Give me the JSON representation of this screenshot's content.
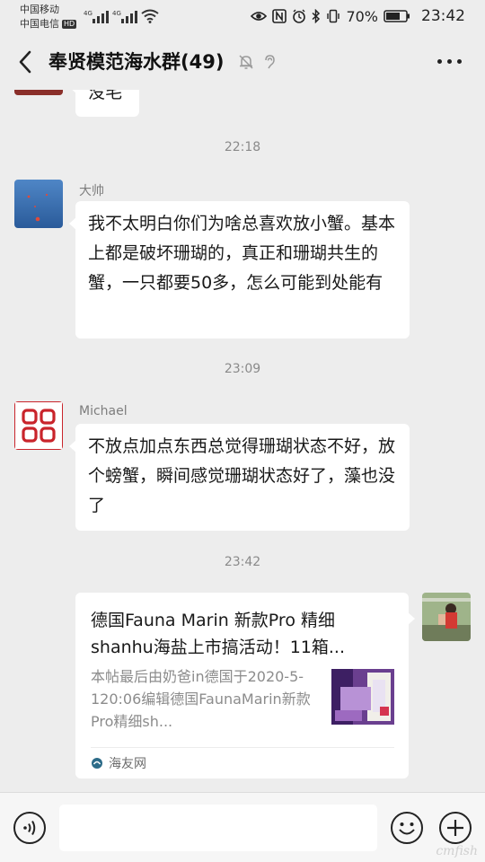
{
  "status_bar": {
    "carrier_1": "中国移动",
    "carrier_2": "中国电信",
    "hd_badge": "HD",
    "net_1": "4G",
    "net_2": "4G",
    "battery": "70%",
    "time": "23:42"
  },
  "title_bar": {
    "title": "奉贤模范海水群(49)"
  },
  "messages": [
    {
      "text": "没毛"
    },
    {
      "time": "22:18"
    },
    {
      "sender": "大帅",
      "text": "我不太明白你们为啥总喜欢放小蟹。基本上都是破坏珊瑚的，真正和珊瑚共生的蟹，一只都要50多，怎么可能到处能有"
    },
    {
      "time": "23:09"
    },
    {
      "sender": "Michael",
      "text": "不放点加点东西总觉得珊瑚状态不好，放个螃蟹，瞬间感觉珊瑚状态好了，藻也没了"
    },
    {
      "time": "23:42"
    },
    {
      "link_card": {
        "title": "德国Fauna Marin 新款Pro 精细shanhu海盐上市搞活动！11箱...",
        "description": "本帖最后由奶爸in德国于2020-5-120:06编辑德国FaunaMarin新款Pro精细sh...",
        "source": "海友网"
      }
    }
  ],
  "input_bar": {
    "placeholder": ""
  },
  "watermark": "cmfish"
}
